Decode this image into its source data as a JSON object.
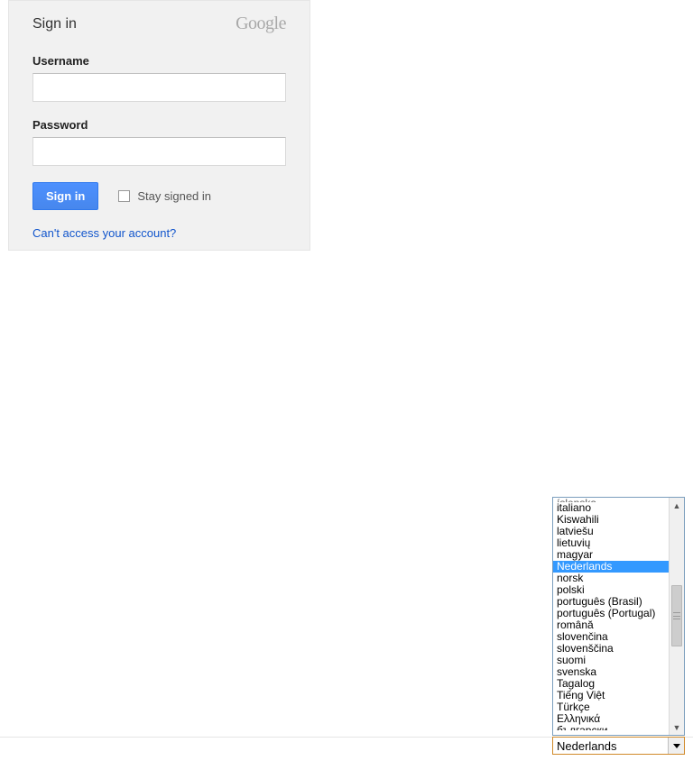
{
  "signin": {
    "title": "Sign in",
    "logo_text": "Google",
    "username_label": "Username",
    "password_label": "Password",
    "button_label": "Sign in",
    "stay_signed_label": "Stay signed in",
    "help_link": "Can't access your account?"
  },
  "language": {
    "selected_value": "Nederlands",
    "highlighted": "Nederlands",
    "options": [
      "íslenska",
      "italiano",
      "Kiswahili",
      "latviešu",
      "lietuvių",
      "magyar",
      "Nederlands",
      "norsk",
      "polski",
      "português (Brasil)",
      "português (Portugal)",
      "română",
      "slovenčina",
      "slovenščina",
      "suomi",
      "svenska",
      "Tagalog",
      "Tiếng Việt",
      "Türkçe",
      "Ελληνικά",
      "български"
    ]
  }
}
